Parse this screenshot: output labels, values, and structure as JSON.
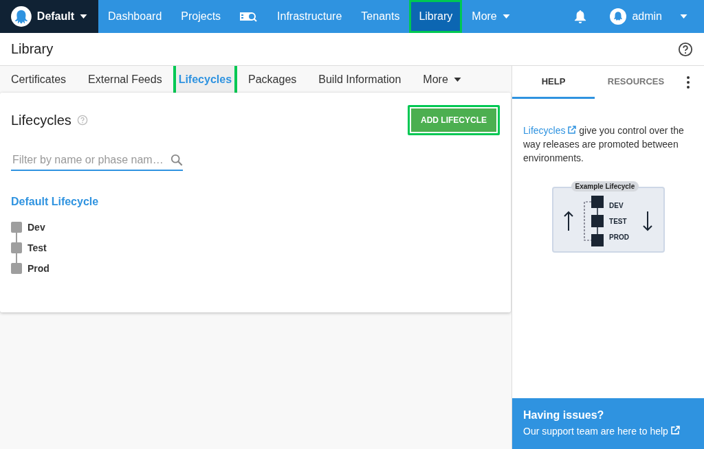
{
  "nav": {
    "space": "Default",
    "items": [
      {
        "kind": "link",
        "label": "Dashboard",
        "selected": false,
        "highlighted": false
      },
      {
        "kind": "link",
        "label": "Projects",
        "selected": false,
        "highlighted": false
      },
      {
        "kind": "icon",
        "selected": false,
        "highlighted": false
      },
      {
        "kind": "link",
        "label": "Infrastructure",
        "selected": false,
        "highlighted": false
      },
      {
        "kind": "link",
        "label": "Tenants",
        "selected": false,
        "highlighted": false
      },
      {
        "kind": "link",
        "label": "Library",
        "selected": true,
        "highlighted": true
      },
      {
        "kind": "menu",
        "label": "More",
        "selected": false,
        "highlighted": false
      }
    ],
    "user": "admin"
  },
  "page_title": "Library",
  "tabs": [
    {
      "label": "Certificates",
      "selected": false,
      "highlighted": false,
      "kind": "tab"
    },
    {
      "label": "External Feeds",
      "selected": false,
      "highlighted": false,
      "kind": "tab"
    },
    {
      "label": "Lifecycles",
      "selected": true,
      "highlighted": true,
      "kind": "tab"
    },
    {
      "label": "Packages",
      "selected": false,
      "highlighted": false,
      "kind": "tab"
    },
    {
      "label": "Build Information",
      "selected": false,
      "highlighted": false,
      "kind": "tab"
    },
    {
      "label": "More",
      "selected": false,
      "highlighted": false,
      "kind": "menu"
    }
  ],
  "card": {
    "title": "Lifecycles",
    "add_button": {
      "label": "ADD LIFECYCLE",
      "highlighted": true
    },
    "filter": {
      "placeholder": "Filter by name or phase nam…"
    },
    "lifecycles": [
      {
        "name": "Default Lifecycle",
        "phases": [
          "Dev",
          "Test",
          "Prod"
        ]
      }
    ]
  },
  "side": {
    "tabs": [
      {
        "label": "HELP",
        "selected": true
      },
      {
        "label": "RESOURCES",
        "selected": false
      }
    ],
    "help": {
      "link": "Lifecycles",
      "text": " give you control over the way releases are promoted between environments."
    },
    "diagram": {
      "label": "Example Lifecycle",
      "phases": [
        "DEV",
        "TEST",
        "PROD"
      ]
    },
    "issues": {
      "title": "Having issues?",
      "link": "Our support team are here to help"
    }
  }
}
